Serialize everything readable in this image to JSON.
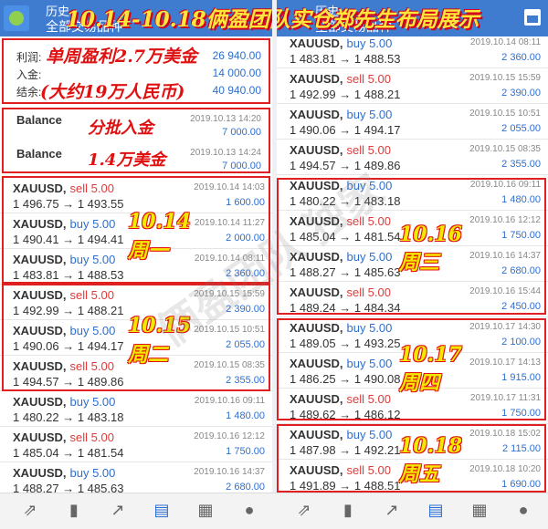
{
  "topbar": {
    "left_title": "历史",
    "left_subtitle": "全部交易品种",
    "right_title": "历史",
    "right_subtitle": "全部交易品种",
    "headline": "10.14-10.18俩盈团队实仓郑先生布局展示"
  },
  "summary": {
    "rows": [
      {
        "label": "利润:",
        "value": "26 940.00"
      },
      {
        "label": "入金:",
        "value": "14 000.00"
      },
      {
        "label": "结余:",
        "value": "40 940.00"
      }
    ],
    "note1": "单周盈利2.7万美金",
    "note2": "(大约19万人民币)"
  },
  "balances": {
    "items": [
      {
        "label": "Balance",
        "date": "2019.10.13 14:20",
        "amount": "7 000.00"
      },
      {
        "label": "Balance",
        "date": "2019.10.13 14:24",
        "amount": "7 000.00"
      }
    ],
    "note1": "分批入金",
    "note2": "1.4万美金"
  },
  "left_trades": [
    {
      "symbol": "XAUUSD,",
      "side": "sell 5.00",
      "type": "sell",
      "prices": "1 496.75 → 1 493.55",
      "date": "2019.10.14 14:03",
      "profit": "1 600.00"
    },
    {
      "symbol": "XAUUSD,",
      "side": "buy 5.00",
      "type": "buy",
      "prices": "1 490.41 → 1 494.41",
      "date": "2019.10.14 11:27",
      "profit": "2 000.00"
    },
    {
      "symbol": "XAUUSD,",
      "side": "buy 5.00",
      "type": "buy",
      "prices": "1 483.81 → 1 488.53",
      "date": "2019.10.14 08:11",
      "profit": "2 360.00"
    },
    {
      "symbol": "XAUUSD,",
      "side": "sell 5.00",
      "type": "sell",
      "prices": "1 492.99 → 1 488.21",
      "date": "2019.10.15 15:59",
      "profit": "2 390.00"
    },
    {
      "symbol": "XAUUSD,",
      "side": "buy 5.00",
      "type": "buy",
      "prices": "1 490.06 → 1 494.17",
      "date": "2019.10.15 10:51",
      "profit": "2 055.00"
    },
    {
      "symbol": "XAUUSD,",
      "side": "sell 5.00",
      "type": "sell",
      "prices": "1 494.57 → 1 489.86",
      "date": "2019.10.15 08:35",
      "profit": "2 355.00"
    },
    {
      "symbol": "XAUUSD,",
      "side": "buy 5.00",
      "type": "buy",
      "prices": "1 480.22 → 1 483.18",
      "date": "2019.10.16 09:11",
      "profit": "1 480.00"
    },
    {
      "symbol": "XAUUSD,",
      "side": "sell 5.00",
      "type": "sell",
      "prices": "1 485.04 → 1 481.54",
      "date": "2019.10.16 12:12",
      "profit": "1 750.00"
    },
    {
      "symbol": "XAUUSD,",
      "side": "buy 5.00",
      "type": "buy",
      "prices": "1 488.27 → 1 485.63",
      "date": "2019.10.16 14:37",
      "profit": "2 680.00"
    }
  ],
  "right_trades": [
    {
      "symbol": "XAUUSD,",
      "side": "buy 5.00",
      "type": "buy",
      "prices": "1 483.81 → 1 488.53",
      "date": "2019.10.14 08:11",
      "profit": "2 360.00"
    },
    {
      "symbol": "XAUUSD,",
      "side": "sell 5.00",
      "type": "sell",
      "prices": "1 492.99 → 1 488.21",
      "date": "2019.10.15 15:59",
      "profit": "2 390.00"
    },
    {
      "symbol": "XAUUSD,",
      "side": "buy 5.00",
      "type": "buy",
      "prices": "1 490.06 → 1 494.17",
      "date": "2019.10.15 10:51",
      "profit": "2 055.00"
    },
    {
      "symbol": "XAUUSD,",
      "side": "sell 5.00",
      "type": "sell",
      "prices": "1 494.57 → 1 489.86",
      "date": "2019.10.15 08:35",
      "profit": "2 355.00"
    },
    {
      "symbol": "XAUUSD,",
      "side": "buy 5.00",
      "type": "buy",
      "prices": "1 480.22 → 1 483.18",
      "date": "2019.10.16 09:11",
      "profit": "1 480.00"
    },
    {
      "symbol": "XAUUSD,",
      "side": "sell 5.00",
      "type": "sell",
      "prices": "1 485.04 → 1 481.54",
      "date": "2019.10.16 12:12",
      "profit": "1 750.00"
    },
    {
      "symbol": "XAUUSD,",
      "side": "buy 5.00",
      "type": "buy",
      "prices": "1 488.27 → 1 485.63",
      "date": "2019.10.16 14:37",
      "profit": "2 680.00"
    },
    {
      "symbol": "XAUUSD,",
      "side": "sell 5.00",
      "type": "sell",
      "prices": "1 489.24 → 1 484.34",
      "date": "2019.10.16 15:44",
      "profit": "2 450.00"
    },
    {
      "symbol": "XAUUSD,",
      "side": "buy 5.00",
      "type": "buy",
      "prices": "1 489.05 → 1 493.25",
      "date": "2019.10.17 14:30",
      "profit": "2 100.00"
    },
    {
      "symbol": "XAUUSD,",
      "side": "buy 5.00",
      "type": "buy",
      "prices": "1 486.25 → 1 490.08",
      "date": "2019.10.17 14:13",
      "profit": "1 915.00"
    },
    {
      "symbol": "XAUUSD,",
      "side": "sell 5.00",
      "type": "sell",
      "prices": "1 489.62 → 1 486.12",
      "date": "2019.10.17 11:31",
      "profit": "1 750.00"
    },
    {
      "symbol": "XAUUSD,",
      "side": "buy 5.00",
      "type": "buy",
      "prices": "1 487.98 → 1 492.21",
      "date": "2019.10.18 15:02",
      "profit": "2 115.00"
    },
    {
      "symbol": "XAUUSD,",
      "side": "sell 5.00",
      "type": "sell",
      "prices": "1 491.89 → 1 488.51",
      "date": "2019.10.18 10:20",
      "profit": "1 690.00"
    }
  ],
  "day_labels": {
    "mon_date": "10.14",
    "mon": "周一",
    "tue_date": "10.15",
    "tue": "周二",
    "wed_date": "10.16",
    "wed": "周三",
    "thu_date": "10.17",
    "thu": "周四",
    "fri_date": "10.18",
    "fri": "周五"
  },
  "watermark": "俩盈团队 独家",
  "nav_icons": [
    "trade-icon",
    "chart-candles-icon",
    "trend-icon",
    "history-inbox-icon",
    "news-icon",
    "chat-icon"
  ],
  "colors": {
    "accent": "#3f7ccf",
    "buy": "#2d6fd0",
    "sell": "#e03a3a",
    "highlight": "#e02020"
  }
}
